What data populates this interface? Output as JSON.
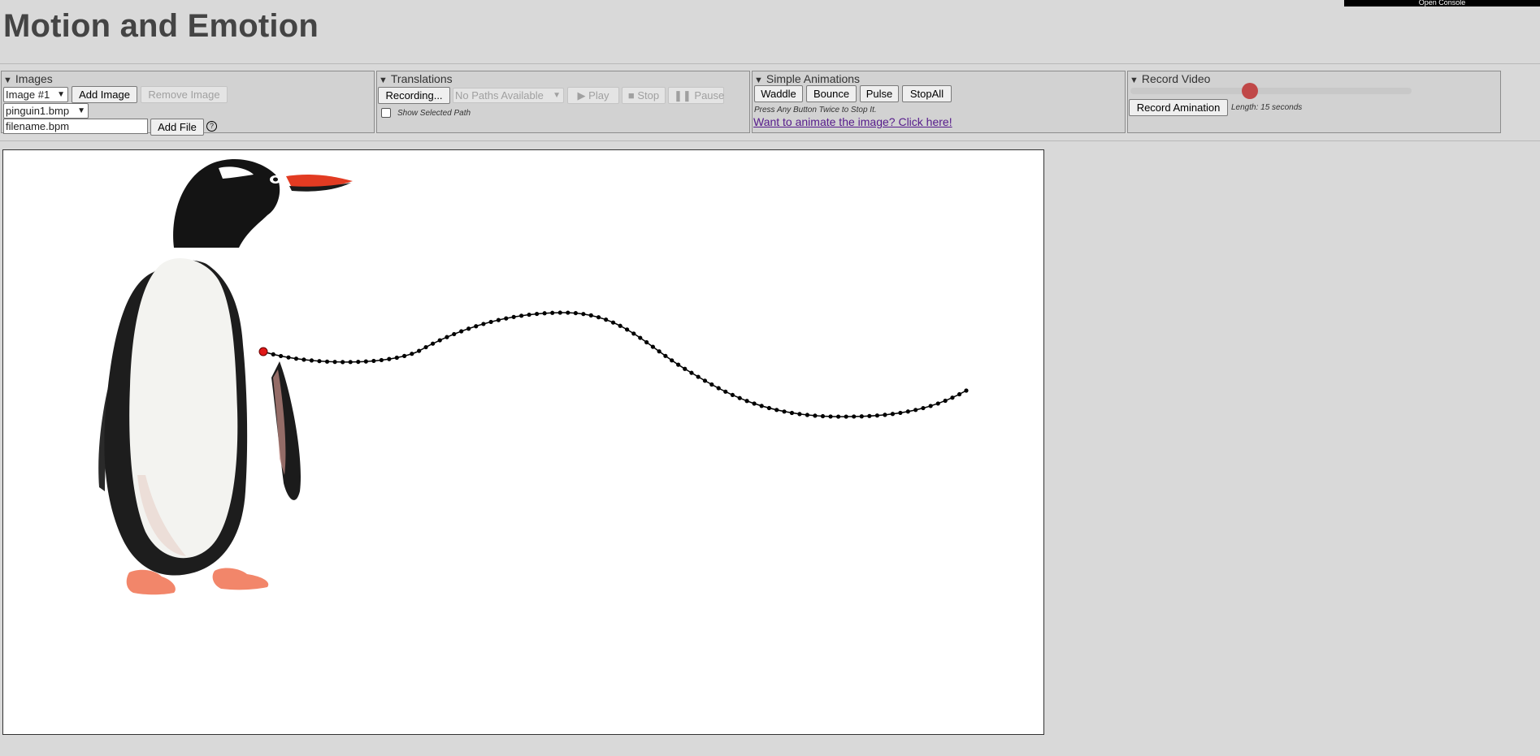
{
  "console_banner": "Open Console",
  "app": {
    "title": "Motion and Emotion"
  },
  "panels": {
    "images": {
      "title": "Images",
      "image_select_value": "Image #1",
      "add_image_label": "Add Image",
      "remove_image_label": "Remove Image",
      "file_select_value": "pinguin1.bmp",
      "filename_value": "filename.bpm",
      "add_file_label": "Add File",
      "help_symbol": "?"
    },
    "translations": {
      "title": "Translations",
      "recording_label": "Recording...",
      "paths_select_value": "No Paths Available",
      "play_label": "▶ Play",
      "stop_label": "■ Stop",
      "pause_label": "❚❚ Pause",
      "show_path_label": "Show Selected Path",
      "show_path_checked": false
    },
    "simple_animations": {
      "title": "Simple Animations",
      "buttons": [
        "Waddle",
        "Bounce",
        "Pulse",
        "StopAll"
      ],
      "hint": "Press Any Button Twice to Stop It.",
      "link_text": "Want to animate the image? Click here!"
    },
    "record_video": {
      "title": "Record Video",
      "record_label": "Record Amination",
      "length_text": "Length: 15 seconds",
      "slider_fraction": 0.42,
      "slider_color": "#c04848"
    }
  },
  "canvas": {
    "image_subject": "gentoo penguin",
    "path_color": "#000000",
    "path_start_color": "#e01818"
  }
}
